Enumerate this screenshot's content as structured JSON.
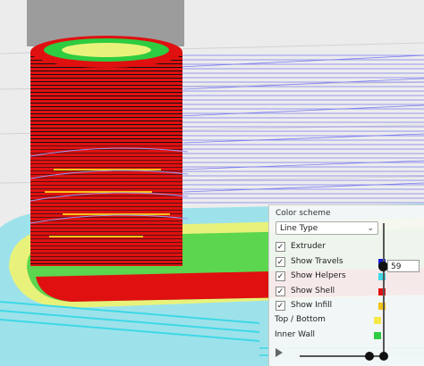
{
  "view_panel": {
    "color_scheme_label": "Color scheme",
    "color_scheme_value": "Line Type",
    "options": [
      {
        "label": "Extruder",
        "checked": true
      },
      {
        "label": "Show Travels",
        "checked": true,
        "color": "#1a1ad6"
      },
      {
        "label": "Show Helpers",
        "checked": true,
        "color": "#3ed8e6"
      },
      {
        "label": "Show Shell",
        "checked": true,
        "color": "#e01010"
      },
      {
        "label": "Show Infill",
        "checked": true,
        "color": "#f0c419"
      }
    ],
    "legend": [
      {
        "label": "Top / Bottom",
        "color": "#f7e84a"
      },
      {
        "label": "Inner Wall",
        "color": "#2ecc40"
      }
    ],
    "layer_value": "59"
  },
  "colors": {
    "background": "#e9e9ea",
    "tower_gray": "#9c9c9c",
    "shell_red": "#e01010",
    "infill_yellow": "#f0c419",
    "travel_blue": "#6060ee",
    "helper_cyan": "#3ed8e6",
    "inner_green": "#2ecc40"
  },
  "icons": {
    "checkbox": "check-icon",
    "dropdown": "chevron-down-icon",
    "play": "play-icon"
  }
}
